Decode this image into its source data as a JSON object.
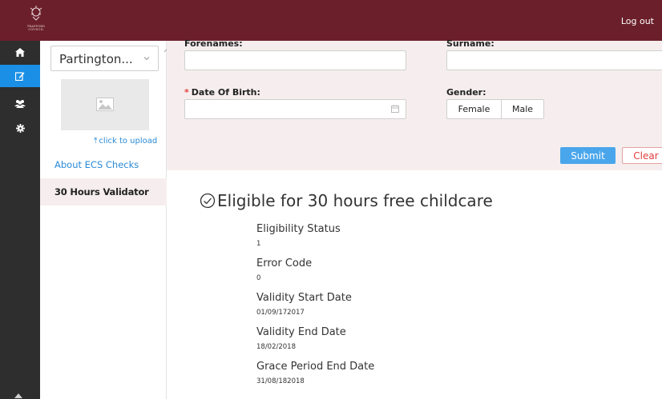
{
  "header": {
    "logo_icon": "council-crest-icon",
    "logo_text": "TRAFFORD COUNCIL",
    "logout_label": "Log out",
    "bg_color": "#6b1f2a"
  },
  "rail": {
    "items": [
      {
        "icon": "home-icon"
      },
      {
        "icon": "edit-icon",
        "active": true
      },
      {
        "icon": "users-icon"
      },
      {
        "icon": "gear-icon"
      }
    ],
    "active_color": "#1b8fe5"
  },
  "sidebar": {
    "setting_select": {
      "value": "Partington..."
    },
    "upload_label": "click to upload",
    "nav": [
      {
        "label": "About ECS Checks"
      },
      {
        "label": "30 Hours Validator",
        "active": true
      }
    ]
  },
  "form": {
    "forenames_label": "Forenames:",
    "surname_label": "Surname:",
    "dob_label": "Date Of Birth:",
    "gender_label": "Gender:",
    "gender_options": [
      "Female",
      "Male"
    ],
    "submit_label": "Submit",
    "clear_label": "Clear",
    "required_marker": "*"
  },
  "result": {
    "title": "Eligible for 30 hours free childcare",
    "fields": [
      {
        "label": "Eligibility Status",
        "value": "1"
      },
      {
        "label": "Error Code",
        "value": "0"
      },
      {
        "label": "Validity Start Date",
        "value": "01/09/172017"
      },
      {
        "label": "Validity End Date",
        "value": "18/02/2018"
      },
      {
        "label": "Grace Period End Date",
        "value": "31/08/182018"
      }
    ]
  }
}
